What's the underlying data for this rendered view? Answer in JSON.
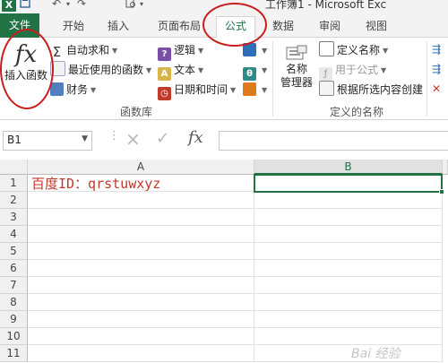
{
  "window": {
    "title": "工作簿1 - Microsoft Exc"
  },
  "tabs": {
    "file": "文件",
    "items": [
      "开始",
      "插入",
      "页面布局",
      "公式",
      "数据",
      "审阅",
      "视图"
    ],
    "active": "公式"
  },
  "ribbon": {
    "function_library": {
      "insert_function": {
        "icon_text": "fx",
        "label": "插入函数"
      },
      "autosum": "自动求和",
      "recently_used": "最近使用的函数",
      "financial": "财务",
      "logical": "逻辑",
      "text": "文本",
      "date_time": "日期和时间",
      "group_label": "函数库"
    },
    "defined_names": {
      "name_manager_line1": "名称",
      "name_manager_line2": "管理器",
      "define_name": "定义名称",
      "use_in_formula": "用于公式",
      "create_from_selection": "根据所选内容创建",
      "group_label": "定义的名称"
    }
  },
  "formula_bar": {
    "name_box": "B1",
    "cancel_icon": "×",
    "enter_icon": "✓",
    "fx_label": "fx",
    "content": ""
  },
  "sheet": {
    "columns": [
      "A",
      "B"
    ],
    "rows": [
      "1",
      "2",
      "3",
      "4",
      "5",
      "6",
      "7",
      "8",
      "9",
      "10",
      "11"
    ],
    "cell_a1": "百度ID：qrstuwxyz",
    "selected_cell": "B1"
  },
  "colors": {
    "accent": "#217346",
    "annotation_red": "#c81e1e",
    "cell_text_red": "#c0392b"
  },
  "watermark": "Bai 经验"
}
